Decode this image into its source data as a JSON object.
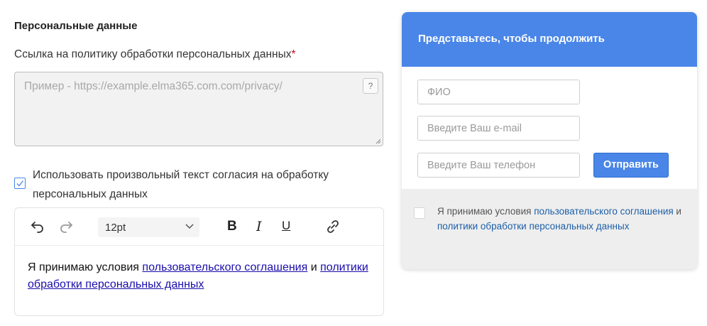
{
  "settings": {
    "section_title": "Персональные данные",
    "policy_label": "Ссылка на политику обработки персональных данных",
    "required_mark": "*",
    "policy_placeholder": "Пример - https://example.elma365.com.com/privacy/",
    "help_label": "?",
    "custom_consent_checked": true,
    "custom_consent_label": "Использовать произвольный текст согласия на обработку персональных данных"
  },
  "editor": {
    "font_size": "12pt",
    "bold": "B",
    "italic": "I",
    "underline": "U",
    "icons": [
      "undo-icon",
      "redo-icon",
      "chevron-down-icon",
      "link-icon"
    ],
    "content": {
      "prefix": "Я принимаю условия ",
      "link1": "пользовательского соглашения",
      "middle": " и ",
      "link2": "политики обработки персональных данных"
    }
  },
  "form": {
    "title": "Представьтесь, чтобы продолжить",
    "name_placeholder": "ФИО",
    "email_placeholder": "Введите Ваш e-mail",
    "phone_placeholder": "Введите Ваш телефон",
    "submit_label": "Отправить",
    "consent_checked": false,
    "consent": {
      "prefix": "Я принимаю условия ",
      "link1": "пользовательского соглашения",
      "middle": " и ",
      "link2": "политики обработки персональных данных"
    }
  },
  "colors": {
    "accent": "#4a86e8",
    "link": "#1a0dab",
    "form_link": "#1d5fa8",
    "required": "#d0021b",
    "footer_bg": "#eeeeee"
  }
}
